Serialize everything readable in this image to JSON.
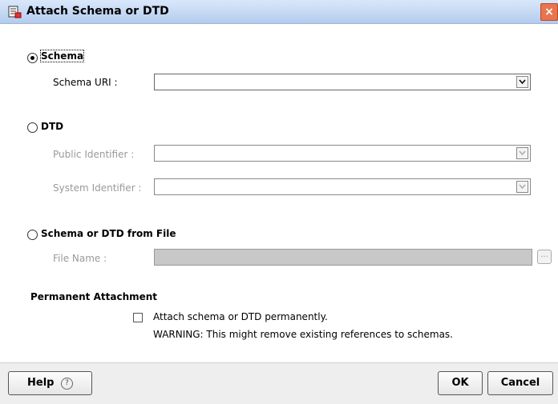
{
  "window": {
    "title": "Attach Schema or DTD",
    "close_glyph": "×"
  },
  "schema_option": {
    "label": "Schema",
    "selected": true,
    "uri_label": "Schema URI :",
    "uri_value": ""
  },
  "dtd_option": {
    "label": "DTD",
    "selected": false,
    "public_label": "Public Identifier :",
    "public_value": "",
    "system_label": "System Identifier :",
    "system_value": ""
  },
  "file_option": {
    "label": "Schema or DTD from File",
    "selected": false,
    "file_label": "File Name :",
    "file_value": "",
    "browse_label": "..."
  },
  "permanent": {
    "heading": "Permanent Attachment",
    "checkbox_label": "Attach schema or DTD permanently.",
    "checked": false,
    "warning": "WARNING: This might remove existing references to schemas."
  },
  "footer": {
    "help_label": "Help",
    "help_icon": "?",
    "ok_label": "OK",
    "cancel_label": "Cancel"
  },
  "colors": {
    "title_bg": "#c3d7f3",
    "close_bg": "#e8754f",
    "disabled_text": "#999999"
  }
}
